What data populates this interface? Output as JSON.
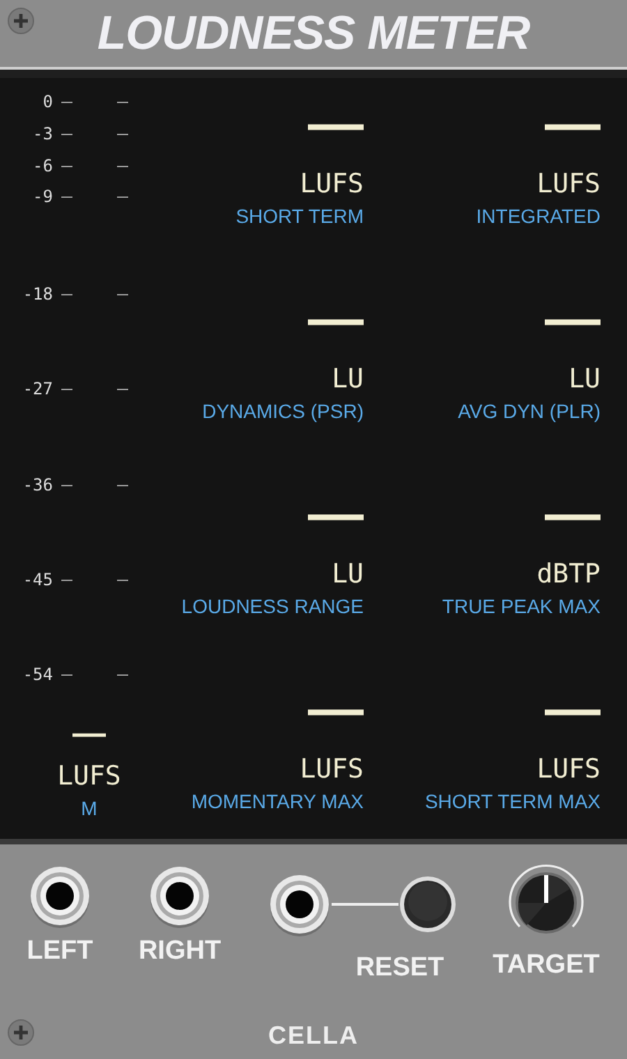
{
  "header": {
    "title": "LOUDNESS METER"
  },
  "scale": {
    "ticks": [
      "0",
      "-3",
      "-6",
      "-9",
      "-18",
      "-27",
      "-36",
      "-45",
      "-54"
    ]
  },
  "momentary": {
    "value": "—",
    "unit": "LUFS",
    "label": "M"
  },
  "readouts": [
    {
      "value": "—",
      "unit": "LUFS",
      "label": "SHORT TERM"
    },
    {
      "value": "—",
      "unit": "LUFS",
      "label": "INTEGRATED"
    },
    {
      "value": "—",
      "unit": "LU",
      "label": "DYNAMICS (PSR)"
    },
    {
      "value": "—",
      "unit": "LU",
      "label": "AVG DYN (PLR)"
    },
    {
      "value": "—",
      "unit": "LU",
      "label": "LOUDNESS RANGE"
    },
    {
      "value": "—",
      "unit": "dBTP",
      "label": "TRUE PEAK MAX"
    },
    {
      "value": "—",
      "unit": "LUFS",
      "label": "MOMENTARY MAX"
    },
    {
      "value": "—",
      "unit": "LUFS",
      "label": "SHORT TERM MAX"
    }
  ],
  "controls": [
    {
      "kind": "jack",
      "label": "LEFT"
    },
    {
      "kind": "jack",
      "label": "RIGHT"
    },
    {
      "kind": "jack_button",
      "label": "RESET"
    },
    {
      "kind": "knob",
      "label": "TARGET"
    }
  ],
  "brand": "CELLA"
}
